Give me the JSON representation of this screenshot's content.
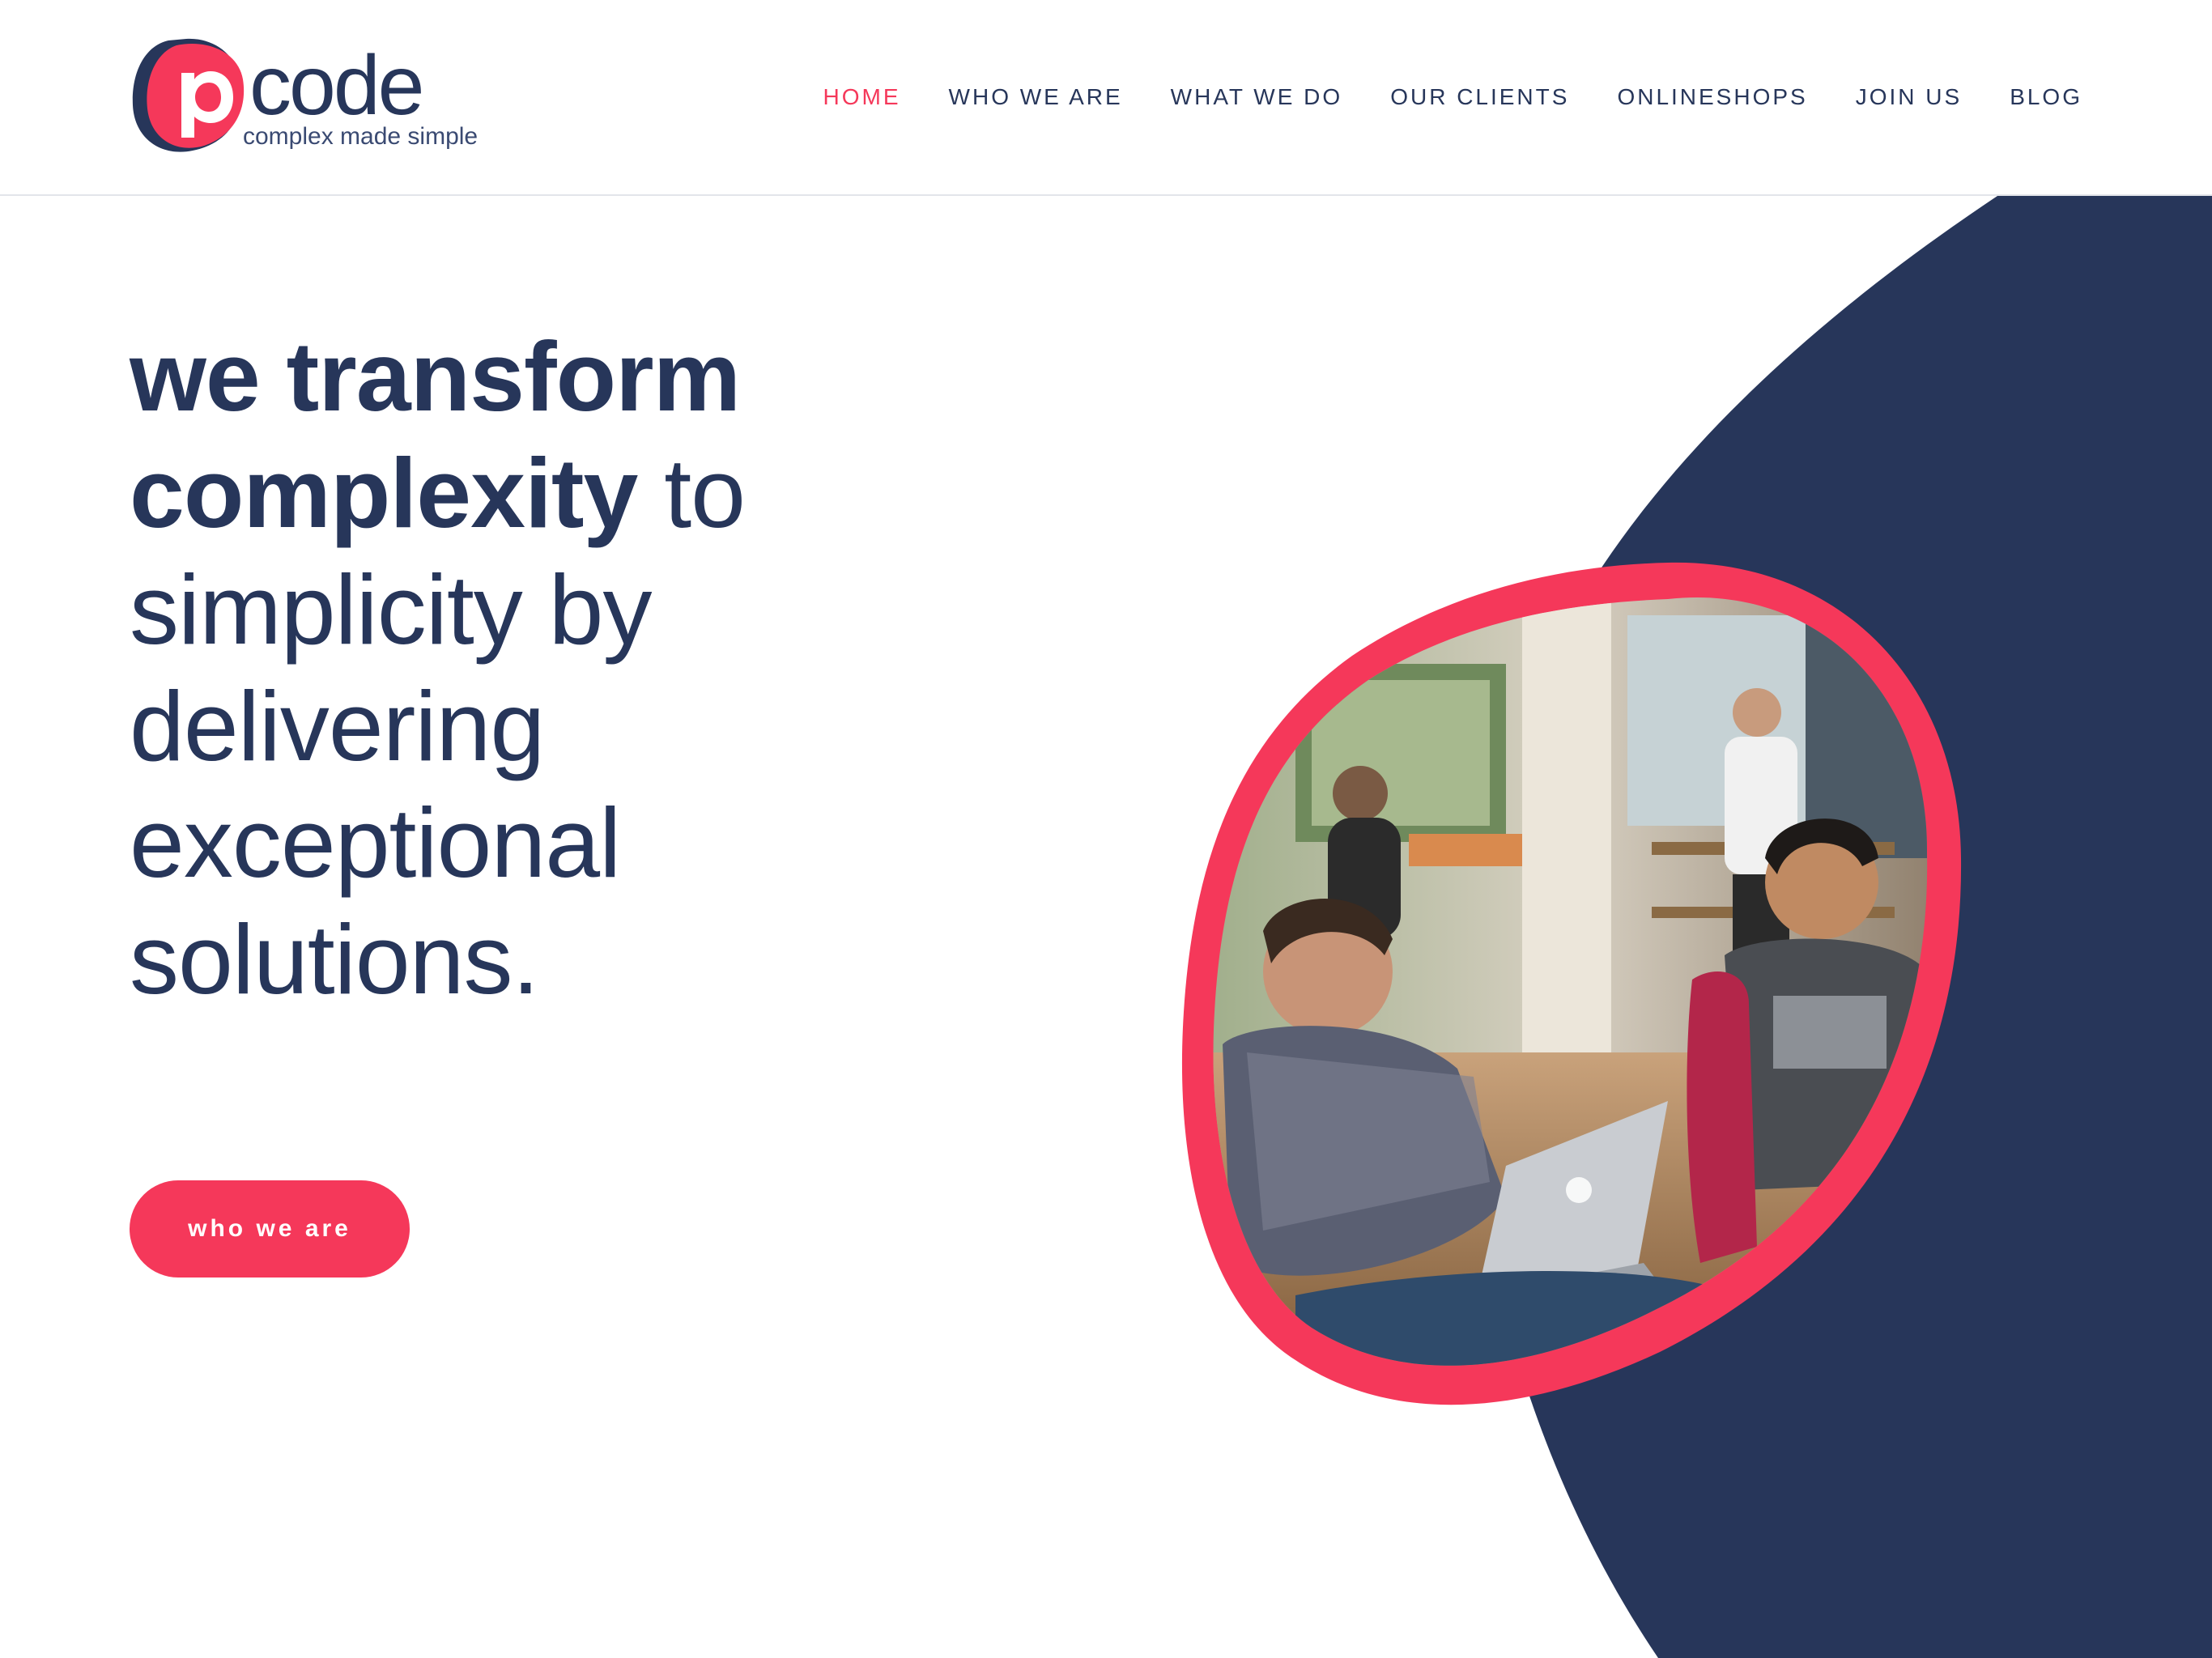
{
  "brand": {
    "logo_letter": "p",
    "name": "code",
    "tagline": "complex made simple"
  },
  "nav": {
    "items": [
      {
        "label": "HOME",
        "active": true
      },
      {
        "label": "WHO WE ARE",
        "active": false
      },
      {
        "label": "WHAT WE DO",
        "active": false
      },
      {
        "label": "OUR CLIENTS",
        "active": false
      },
      {
        "label": "ONLINESHOPS",
        "active": false
      },
      {
        "label": "JOIN US",
        "active": false
      },
      {
        "label": "BLOG",
        "active": false
      }
    ]
  },
  "hero": {
    "headline_bold_1": "we transform",
    "headline_bold_2": "complexity",
    "headline_rest_1": " to",
    "headline_rest_2": "simplicity by",
    "headline_rest_3": "delivering",
    "headline_rest_4": "exceptional",
    "headline_rest_5": "solutions.",
    "cta_label": "who we are"
  },
  "colors": {
    "accent": "#f5385a",
    "navy": "#27365a",
    "background": "#ffffff"
  },
  "icons": {
    "logo": "pcode-logo-mark"
  }
}
